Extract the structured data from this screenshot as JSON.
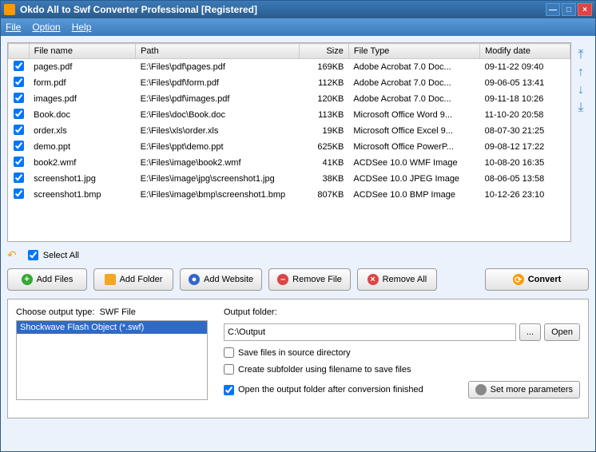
{
  "window": {
    "title": "Okdo All to Swf Converter Professional [Registered]"
  },
  "menu": {
    "file": "File",
    "option": "Option",
    "help": "Help"
  },
  "columns": {
    "name": "File name",
    "path": "Path",
    "size": "Size",
    "type": "File Type",
    "date": "Modify date"
  },
  "files": [
    {
      "checked": true,
      "name": "pages.pdf",
      "path": "E:\\Files\\pdf\\pages.pdf",
      "size": "169KB",
      "type": "Adobe Acrobat 7.0 Doc...",
      "date": "09-11-22 09:40"
    },
    {
      "checked": true,
      "name": "form.pdf",
      "path": "E:\\Files\\pdf\\form.pdf",
      "size": "112KB",
      "type": "Adobe Acrobat 7.0 Doc...",
      "date": "09-06-05 13:41"
    },
    {
      "checked": true,
      "name": "images.pdf",
      "path": "E:\\Files\\pdf\\images.pdf",
      "size": "120KB",
      "type": "Adobe Acrobat 7.0 Doc...",
      "date": "09-11-18 10:26"
    },
    {
      "checked": true,
      "name": "Book.doc",
      "path": "E:\\Files\\doc\\Book.doc",
      "size": "113KB",
      "type": "Microsoft Office Word 9...",
      "date": "11-10-20 20:58"
    },
    {
      "checked": true,
      "name": "order.xls",
      "path": "E:\\Files\\xls\\order.xls",
      "size": "19KB",
      "type": "Microsoft Office Excel 9...",
      "date": "08-07-30 21:25"
    },
    {
      "checked": true,
      "name": "demo.ppt",
      "path": "E:\\Files\\ppt\\demo.ppt",
      "size": "625KB",
      "type": "Microsoft Office PowerP...",
      "date": "09-08-12 17:22"
    },
    {
      "checked": true,
      "name": "book2.wmf",
      "path": "E:\\Files\\image\\book2.wmf",
      "size": "41KB",
      "type": "ACDSee 10.0 WMF Image",
      "date": "10-08-20 16:35"
    },
    {
      "checked": true,
      "name": "screenshot1.jpg",
      "path": "E:\\Files\\image\\jpg\\screenshot1.jpg",
      "size": "38KB",
      "type": "ACDSee 10.0 JPEG Image",
      "date": "08-06-05 13:58"
    },
    {
      "checked": true,
      "name": "screenshot1.bmp",
      "path": "E:\\Files\\image\\bmp\\screenshot1.bmp",
      "size": "807KB",
      "type": "ACDSee 10.0 BMP Image",
      "date": "10-12-26 23:10"
    }
  ],
  "selectAll": {
    "label": "Select All",
    "checked": true
  },
  "buttons": {
    "addFiles": "Add Files",
    "addFolder": "Add Folder",
    "addWebsite": "Add Website",
    "removeFile": "Remove File",
    "removeAll": "Remove All",
    "convert": "Convert"
  },
  "outputType": {
    "label": "Choose output type:",
    "value": "SWF File",
    "selected": "Shockwave Flash Object (*.swf)"
  },
  "outputFolder": {
    "label": "Output folder:",
    "value": "C:\\Output",
    "browse": "...",
    "open": "Open"
  },
  "options": {
    "saveInSource": {
      "label": "Save files in source directory",
      "checked": false
    },
    "createSubfolder": {
      "label": "Create subfolder using filename to save files",
      "checked": false
    },
    "openAfter": {
      "label": "Open the output folder after conversion finished",
      "checked": true
    }
  },
  "moreParams": "Set more parameters"
}
